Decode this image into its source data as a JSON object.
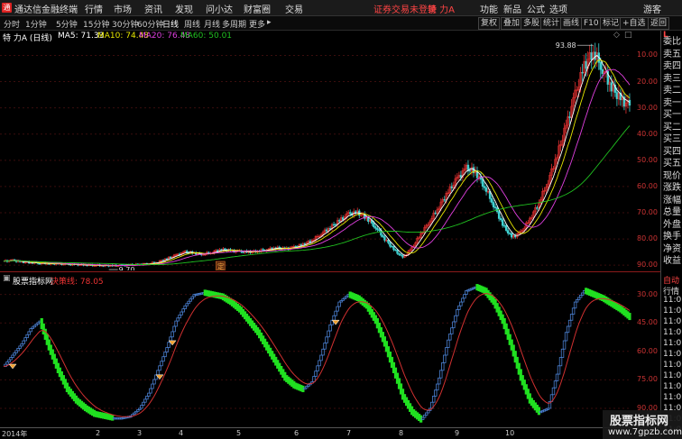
{
  "titlebar": {
    "app_title": "通达信金融终端",
    "menus": [
      "行情",
      "市场",
      "资讯",
      "发现",
      "问小达",
      "财富圈",
      "交易"
    ],
    "login_status": "证券交易未登录",
    "stock_name": "特 力A",
    "right_menus": [
      "功能",
      "新品",
      "公式",
      "选项"
    ],
    "guest": "游客"
  },
  "toolbar": {
    "periods": [
      "分时",
      "1分钟",
      "5分钟",
      "15分钟",
      "30分钟",
      "60分钟",
      "日线",
      "周线",
      "月线",
      "多周期",
      "更多"
    ],
    "active_period": "日线",
    "right_buttons": [
      "复权",
      "叠加",
      "多股",
      "统计",
      "画线",
      "F10",
      "标记",
      "+自选",
      "返回"
    ]
  },
  "price_panel": {
    "stock_label": "特 力A (日线)",
    "ma5": "MA5: 71.33",
    "ma10": "MA10: 74.48",
    "ma20": "MA20: 76.48",
    "ma60": "MA60: 50.01",
    "high_label": "93.88",
    "low_label": "9.70",
    "marker": "定",
    "y_ticks": [
      "90.00",
      "80.00",
      "70.00",
      "60.00",
      "50.00",
      "40.00",
      "30.00",
      "20.00",
      "10.00"
    ]
  },
  "indicator_panel": {
    "source": "股票指标网",
    "line_label": "决策线: 78.05",
    "y_ticks": [
      "90.00",
      "75.00",
      "60.00",
      "45.00",
      "30.00"
    ]
  },
  "x_axis": [
    "2014年",
    "2",
    "3",
    "4",
    "5",
    "6",
    "7",
    "8",
    "9",
    "10"
  ],
  "right_panel": {
    "top_label": "L",
    "items": [
      "委比",
      "卖五",
      "卖四",
      "卖三",
      "卖二",
      "卖一",
      "买一",
      "买二",
      "买三",
      "买四",
      "买五",
      "现价",
      "涨跌",
      "涨幅",
      "总量",
      "外盘",
      "换手",
      "净资",
      "收益"
    ],
    "lower_items": [
      "自动",
      "行情",
      "11:0",
      "11:0",
      "11:0",
      "11:0",
      "11:0",
      "11:0",
      "11:0",
      "11:0",
      "11:0",
      "11:0",
      "11:0",
      "11:0",
      "11:0"
    ]
  },
  "watermark": {
    "title": "股票指标网",
    "url": "www.7gpzb.com"
  },
  "colors": {
    "ma5": "#ffffff",
    "ma10": "#e6e600",
    "ma20": "#e040e0",
    "ma60": "#20c020",
    "up": "#e03030",
    "down": "#40d0d0",
    "ind_blue": "#4a7fd0",
    "ind_green": "#20e020",
    "ind_red": "#d03030"
  },
  "chart_data": [
    {
      "type": "candlestick",
      "title": "特 力A (日线)",
      "ylim": [
        8,
        96
      ],
      "y_ticks": [
        10,
        20,
        30,
        40,
        50,
        60,
        70,
        80,
        90
      ],
      "close": [
        11.5,
        11.8,
        11.2,
        11.0,
        10.8,
        10.6,
        10.5,
        10.3,
        10.2,
        10.1,
        10.0,
        9.9,
        9.8,
        9.9,
        10.1,
        10.3,
        10.6,
        11.2,
        12.5,
        13.8,
        15.0,
        14.6,
        14.2,
        15.0,
        16.0,
        15.5,
        15.2,
        15.0,
        15.4,
        16.0,
        16.6,
        16.2,
        16.8,
        17.8,
        19.5,
        22.0,
        24.5,
        27.0,
        29.5,
        30.0,
        28.0,
        24.5,
        20.0,
        16.0,
        12.8,
        16.5,
        22.0,
        27.0,
        32.5,
        38.0,
        43.0,
        47.0,
        45.5,
        40.0,
        33.0,
        25.5,
        20.5,
        22.5,
        27.5,
        34.0,
        42.0,
        52.0,
        63.0,
        75.0,
        86.0,
        91.5,
        85.0,
        78.0,
        73.0,
        71.0
      ],
      "ma5_last": 71.33,
      "ma10_last": 74.48,
      "ma20_last": 76.48,
      "ma60_last": 50.01,
      "high": 93.88,
      "low": 9.7
    },
    {
      "type": "line",
      "title": "股票指标网",
      "series": [
        {
          "name": "决策线",
          "last": 78.05
        }
      ],
      "ylim": [
        20,
        96
      ],
      "y_ticks": [
        30,
        45,
        60,
        75,
        90
      ],
      "main": [
        52,
        58,
        64,
        72,
        76,
        62,
        50,
        40,
        34,
        30,
        27,
        26,
        25,
        25,
        26,
        30,
        38,
        50,
        62,
        76,
        84,
        90,
        91,
        90,
        89,
        86,
        82,
        76,
        70,
        62,
        54,
        46,
        42,
        40,
        44,
        58,
        74,
        86,
        90,
        88,
        84,
        76,
        64,
        50,
        36,
        28,
        24,
        30,
        46,
        66,
        82,
        92,
        94,
        92,
        86,
        76,
        62,
        46,
        34,
        28,
        30,
        48,
        70,
        86,
        92,
        90,
        88,
        85,
        82,
        78
      ]
    }
  ]
}
